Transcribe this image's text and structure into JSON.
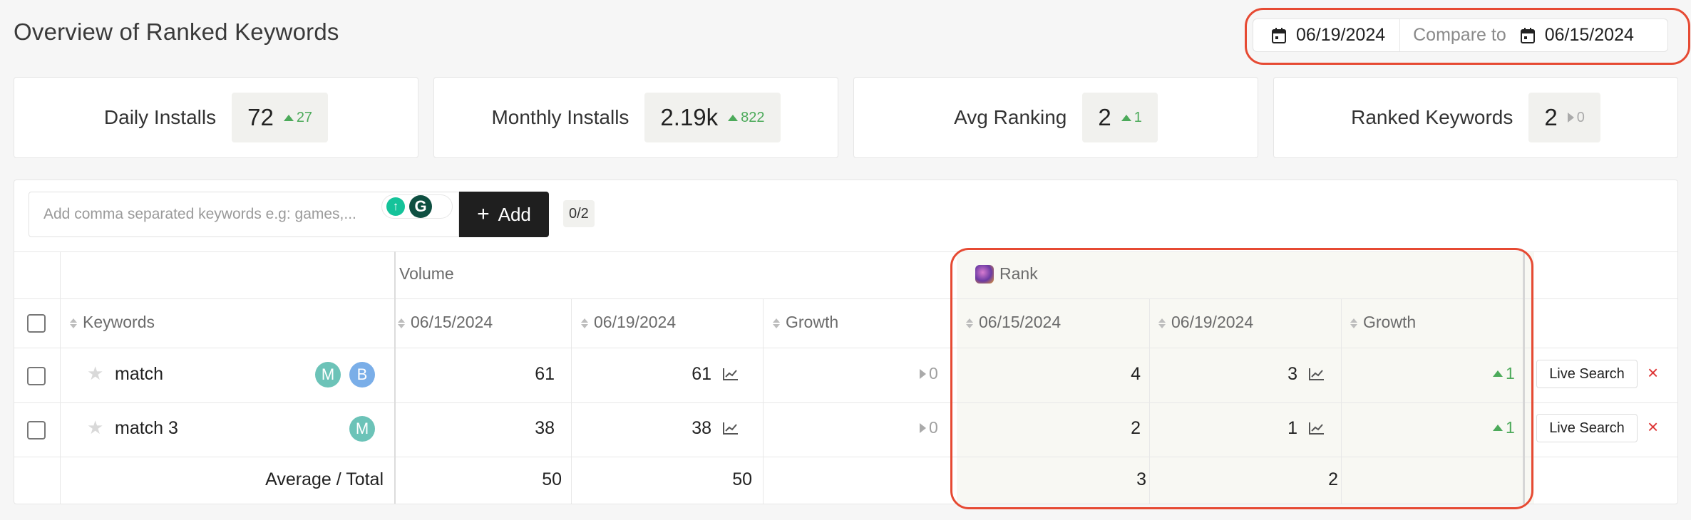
{
  "page": {
    "title": "Overview of Ranked Keywords"
  },
  "date_range": {
    "date": "06/19/2024",
    "compare_label": "Compare to",
    "compare_date": "06/15/2024"
  },
  "kpis": [
    {
      "label": "Daily Installs",
      "value": "72",
      "delta": "27",
      "trend": "up"
    },
    {
      "label": "Monthly Installs",
      "value": "2.19k",
      "delta": "822",
      "trend": "up"
    },
    {
      "label": "Avg Ranking",
      "value": "2",
      "delta": "1",
      "trend": "up"
    },
    {
      "label": "Ranked Keywords",
      "value": "2",
      "delta": "0",
      "trend": "neutral"
    }
  ],
  "keyword_input": {
    "placeholder": "Add comma separated keywords e.g: games,...",
    "value": ""
  },
  "add_button": {
    "label": "Add"
  },
  "keyword_count": "0/2",
  "table": {
    "groups": {
      "volume": "Volume",
      "rank": "Rank"
    },
    "columns": {
      "keywords": "Keywords",
      "vol_prev": "06/15/2024",
      "vol_curr": "06/19/2024",
      "vol_growth": "Growth",
      "rank_prev": "06/15/2024",
      "rank_curr": "06/19/2024",
      "rank_growth": "Growth"
    },
    "rows": [
      {
        "keyword": "match",
        "badges": [
          {
            "letter": "M",
            "color": "#6cc3b8"
          },
          {
            "letter": "B",
            "color": "#7aaee8"
          }
        ],
        "vol_prev": "61",
        "vol_curr": "61",
        "vol_growth": "0",
        "rank_prev": "4",
        "rank_curr": "3",
        "rank_growth": "1",
        "live_search": "Live Search",
        "delete": "×"
      },
      {
        "keyword": "match 3",
        "badges": [
          {
            "letter": "M",
            "color": "#6cc3b8"
          }
        ],
        "vol_prev": "38",
        "vol_curr": "38",
        "vol_growth": "0",
        "rank_prev": "2",
        "rank_curr": "1",
        "rank_growth": "1",
        "live_search": "Live Search",
        "delete": "×"
      }
    ],
    "footer": {
      "label": "Average / Total",
      "vol_prev": "50",
      "vol_curr": "50",
      "rank_prev": "3",
      "rank_curr": "2"
    }
  },
  "colors": {
    "accent_dark": "#1f1f1f",
    "positive": "#4caa5a",
    "highlight": "#e64a33",
    "delete": "#dd3333"
  }
}
